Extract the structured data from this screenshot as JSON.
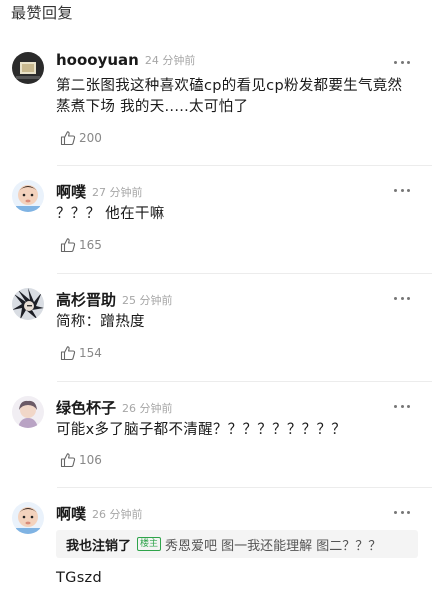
{
  "header": {
    "title": "最赞回复"
  },
  "comments": [
    {
      "username": "hoooyuan",
      "time": "24 分钟前",
      "text": "第二张图我这种喜欢磕cp的看见cp粉发都要生气竟然蒸煮下场 我的天.....太可怕了",
      "likes": "200"
    },
    {
      "username": "啊噗",
      "time": "27 分钟前",
      "text": "？？？ 他在干嘛",
      "likes": "165"
    },
    {
      "username": "高杉晋助",
      "time": "25 分钟前",
      "text": "简称：蹭热度",
      "likes": "154"
    },
    {
      "username": "绿色杯子",
      "time": "26 分钟前",
      "text": "可能x多了脑子都不清醒？？？？？？？？？",
      "likes": "106"
    },
    {
      "username": "啊噗",
      "time": "26 分钟前",
      "quote": {
        "user": "我也注销了",
        "badge": "楼主",
        "text": "秀恩爱吧 图一我还能理解 图二？？？"
      },
      "text": "TGszd"
    }
  ],
  "colors": {
    "accent_badge": "#2fa44b",
    "muted": "#a6a6a6",
    "divider": "#ececec"
  },
  "icons": {
    "like": "thumbs-up-outline-icon",
    "more": "ellipsis-icon"
  }
}
